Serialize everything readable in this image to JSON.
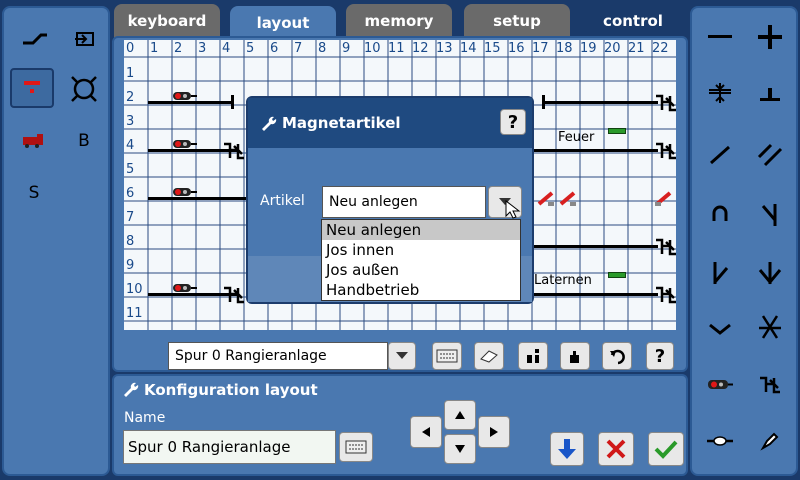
{
  "tabs": [
    {
      "label": "keyboard",
      "active": false
    },
    {
      "label": "layout",
      "active": true
    },
    {
      "label": "memory",
      "active": false
    },
    {
      "label": "setup",
      "active": false
    },
    {
      "label": "control",
      "active": false
    }
  ],
  "left_panel": {
    "letter_b": "B",
    "letter_s": "S"
  },
  "grid": {
    "columns": [
      "0",
      "1",
      "2",
      "3",
      "4",
      "5",
      "6",
      "7",
      "8",
      "9",
      "10",
      "11",
      "12",
      "13",
      "14",
      "15",
      "16",
      "17",
      "18",
      "19",
      "20",
      "21",
      "22"
    ],
    "rows": [
      "1",
      "2",
      "3",
      "4",
      "5",
      "6",
      "7",
      "8",
      "9",
      "10",
      "11"
    ],
    "label_feuer": "Feuer",
    "label_laternen": "Laternen"
  },
  "layout_toolbar": {
    "layout_select": "Spur 0 Rangieranlage",
    "help": "?"
  },
  "dialog": {
    "title": "Magnetartikel",
    "help": "?",
    "artikel_label": "Artikel",
    "artikel_value": "Neu anlegen",
    "options": [
      "Neu anlegen",
      "Jos innen",
      "Jos außen",
      "Handbetrieb"
    ]
  },
  "config": {
    "title": "Konfiguration layout",
    "name_label": "Name",
    "name_value": "Spur 0 Rangieranlage"
  },
  "colors": {
    "background": "#1a3a6a",
    "panel": "#4a78b0",
    "tab_inactive": "#6a6a6a",
    "confirm_green": "#2a9a2a",
    "cancel_red": "#d01818",
    "arrow_blue": "#1a56c8"
  }
}
